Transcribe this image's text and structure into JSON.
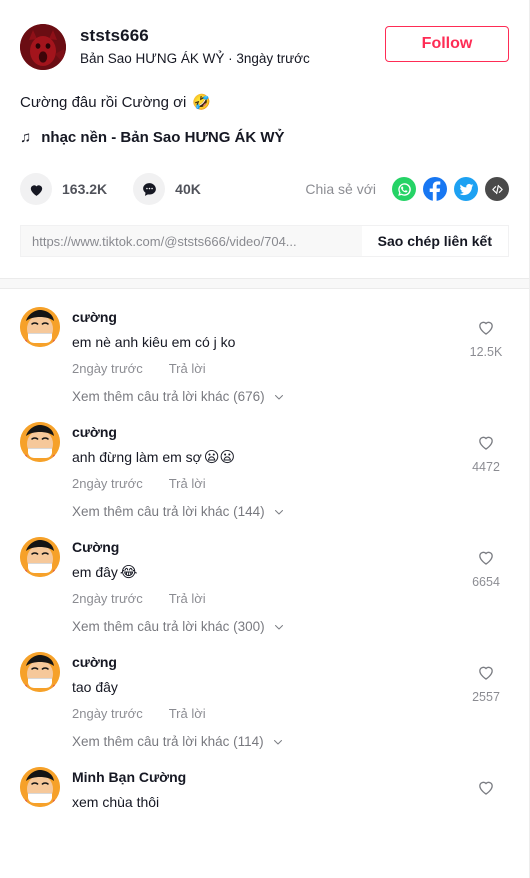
{
  "post": {
    "author_name": "ststs666",
    "author_subtitle": "Bản Sao HƯNG ÁK WỶ · 3ngày trước",
    "follow_label": "Follow",
    "caption": "Cường đâu rồi Cường ơi",
    "caption_emoji": "🤣",
    "music_note": "♫",
    "music_title": "nhạc nền - Bản Sao HƯNG ÁK WỶ",
    "avatar_alt": "devil-avatar"
  },
  "stats": {
    "like_count": "163.2K",
    "comment_count": "40K",
    "share_label": "Chia sẻ với",
    "share_targets": [
      {
        "name": "whatsapp-share-icon",
        "color": "#25D366"
      },
      {
        "name": "facebook-share-icon",
        "color": "#1877F2"
      },
      {
        "name": "twitter-share-icon",
        "color": "#1DA1F2"
      },
      {
        "name": "embed-code-share-icon",
        "color": "#4A4A4A"
      }
    ]
  },
  "copy_link": {
    "url": "https://www.tiktok.com/@ststs666/video/704...",
    "button_label": "Sao chép liên kết"
  },
  "comments": [
    {
      "name": "cường",
      "text": "em nè anh kiêu em có j ko",
      "emoji": "",
      "time": "2ngày trước",
      "reply_label": "Trả lời",
      "more_replies": "Xem thêm câu trả lời khác (676)",
      "likes": "12.5K"
    },
    {
      "name": "cường",
      "text": "anh đừng làm em sợ",
      "emoji": "😦😦",
      "time": "2ngày trước",
      "reply_label": "Trả lời",
      "more_replies": "Xem thêm câu trả lời khác (144)",
      "likes": "4472"
    },
    {
      "name": "Cường",
      "text": "em đây",
      "emoji": "😂",
      "time": "2ngày trước",
      "reply_label": "Trả lời",
      "more_replies": "Xem thêm câu trả lời khác (300)",
      "likes": "6654"
    },
    {
      "name": "cường",
      "text": "tao đây",
      "emoji": "",
      "time": "2ngày trước",
      "reply_label": "Trả lời",
      "more_replies": "Xem thêm câu trả lời khác (114)",
      "likes": "2557"
    },
    {
      "name": "Minh Bạn Cường",
      "text": "xem chùa thôi",
      "emoji": "",
      "time": "",
      "reply_label": "",
      "more_replies": "",
      "likes": ""
    }
  ],
  "colors": {
    "accent": "#FE2C55",
    "text": "#161823",
    "muted": "#16182380",
    "band": "#F8F8F8"
  }
}
